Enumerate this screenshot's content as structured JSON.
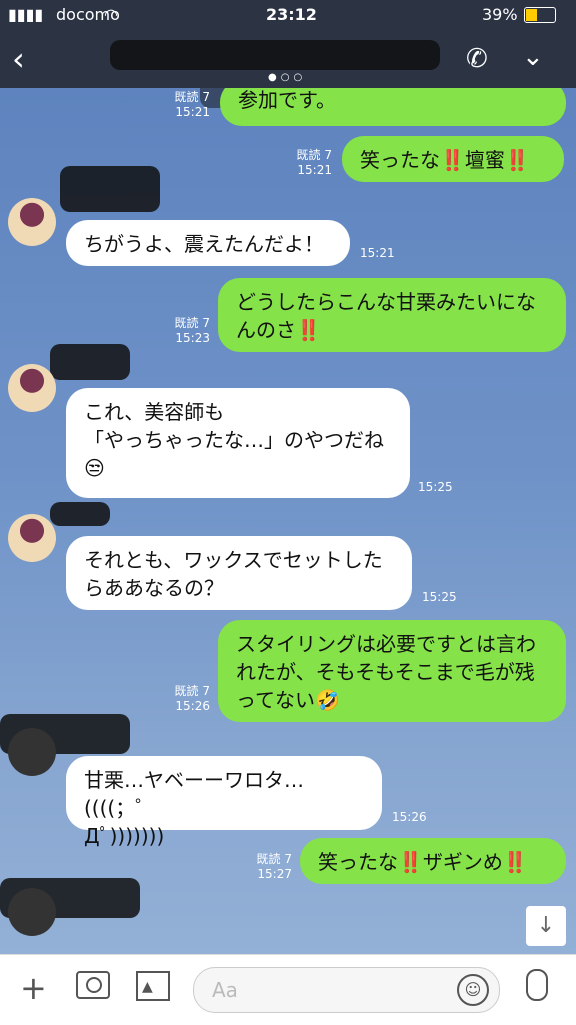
{
  "status": {
    "carrier": "docomo",
    "time": "23:12",
    "battery": "39%"
  },
  "header": {
    "back_icon": "chevron-left-icon",
    "call_icon": "phone-icon",
    "menu_icon": "chevron-down-icon"
  },
  "messages": [
    {
      "side": "sent",
      "read": "既読 7",
      "time": "15:21",
      "text": "参加です。"
    },
    {
      "side": "sent",
      "read": "既読 7",
      "time": "15:21",
      "text": "笑ったな‼️壇蜜‼️"
    },
    {
      "side": "recv",
      "time": "15:21",
      "text": "ちがうよ、震えたんだよ！"
    },
    {
      "side": "sent",
      "read": "既読 7",
      "time": "15:23",
      "text": "どうしたらこんな甘栗みたいにな\nんのさ‼️"
    },
    {
      "side": "recv",
      "time": "15:25",
      "text": "これ、美容師も\n「やっちゃったな…」のやつだね\n😒"
    },
    {
      "side": "recv",
      "time": "15:25",
      "text": "それとも、ワックスでセットした\nらああなるの？"
    },
    {
      "side": "sent",
      "read": "既読 7",
      "time": "15:26",
      "text": "スタイリングは必要ですとは言わ\nれたが、そもそもそこまで毛が残\nってない🤣"
    },
    {
      "side": "recv",
      "time": "15:26",
      "text": "甘栗…ヤベーーワロタ…((((；゜\nДﾟ)))))))"
    },
    {
      "side": "sent",
      "read": "既読 7",
      "time": "15:27",
      "text": "笑ったな‼️ザギンめ‼️"
    }
  ],
  "composer": {
    "placeholder": "Aa"
  }
}
